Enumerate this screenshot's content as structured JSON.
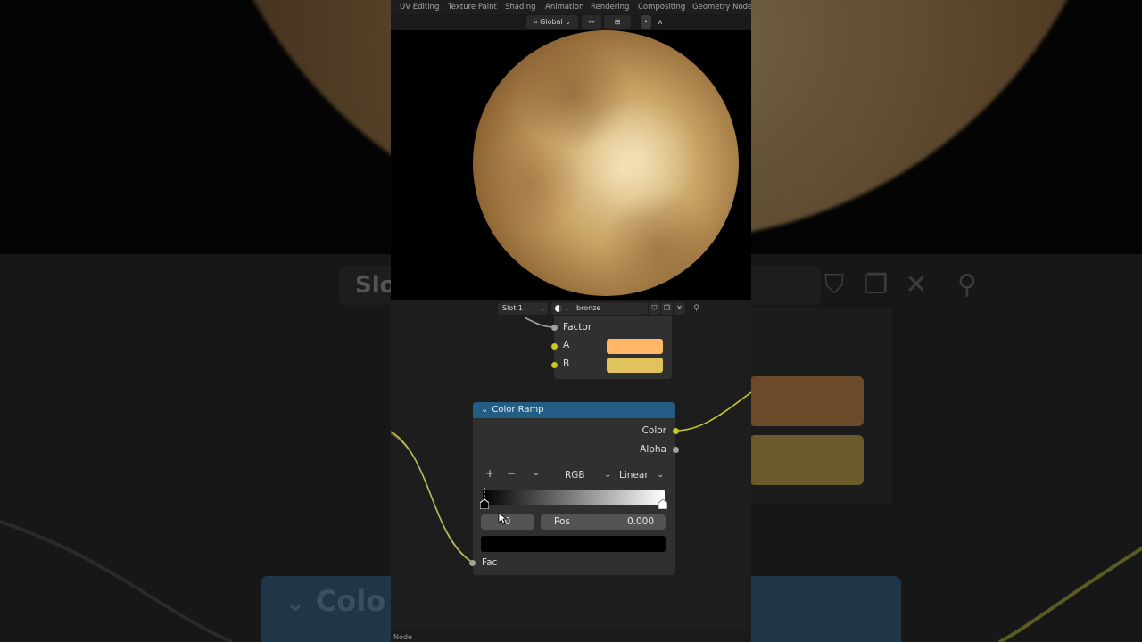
{
  "workspace_tabs": [
    "UV Editing",
    "Texture Paint",
    "Shading",
    "Animation",
    "Rendering",
    "Compositing",
    "Geometry Nodes"
  ],
  "toolbar": {
    "orientation": "Global"
  },
  "node_header": {
    "slot": "Slot 1",
    "material": "bronze",
    "icons": [
      "shield-icon",
      "duplicate-icon",
      "close-icon",
      "pin-icon"
    ]
  },
  "mix_node": {
    "factor_label": "Factor",
    "a_label": "A",
    "b_label": "B",
    "a_color": "#FFB665",
    "b_color": "#E0C45B"
  },
  "color_ramp": {
    "title": "Color Ramp",
    "outputs": [
      "Color",
      "Alpha"
    ],
    "color_mode": "RGB",
    "interpolation": "Linear",
    "stop_index": "0",
    "pos_label": "Pos",
    "pos_value": "0.000",
    "input_label": "Fac",
    "selected_color": "#000000"
  },
  "colors": {
    "header": "#245D84",
    "socket_yellow": "#C7C729",
    "socket_gray": "#A1A1A1"
  },
  "status_bar": {
    "text": "Node"
  },
  "background_overlay": {
    "slot_text": "Slot",
    "header_text": "Colo"
  }
}
